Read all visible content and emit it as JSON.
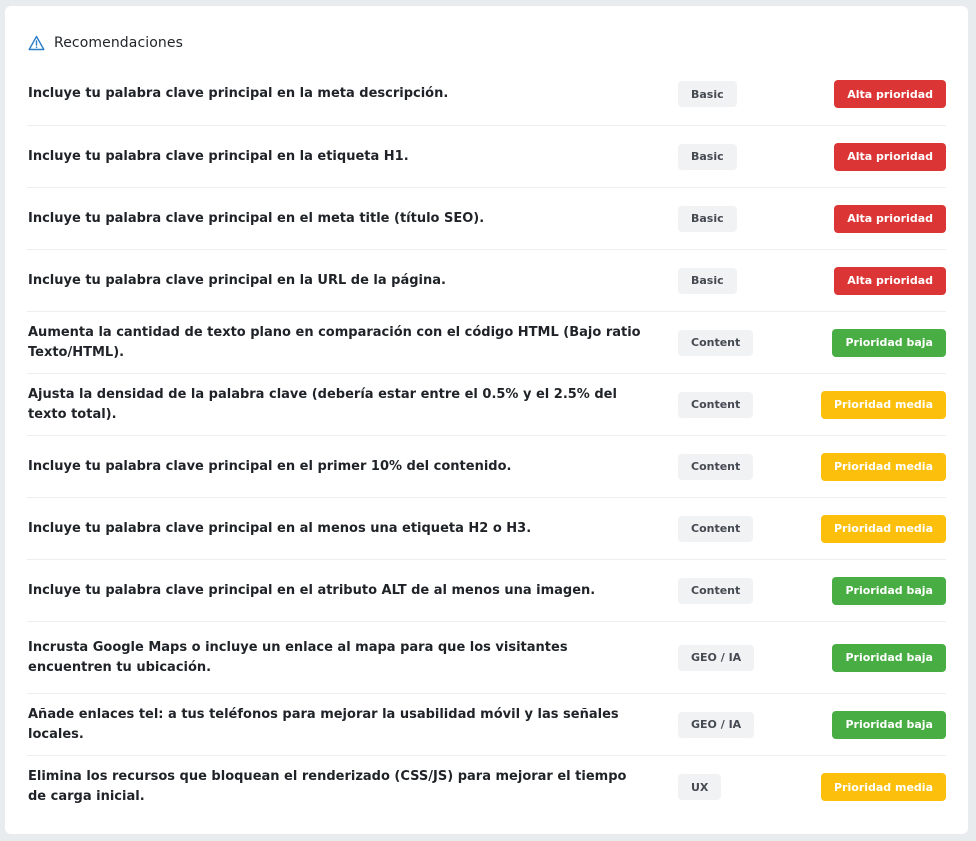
{
  "header": {
    "title": "Recomendaciones",
    "icon": "warning-icon",
    "icon_color": "#2b7ec7"
  },
  "colors": {
    "high": "#dc3535",
    "low": "#48ad42",
    "medium": "#fcbf0b"
  },
  "recommendations": [
    {
      "text": "Incluye tu palabra clave principal en la meta descripción.",
      "tag": "Basic",
      "priority": "Alta prioridad",
      "level": "high"
    },
    {
      "text": "Incluye tu palabra clave principal en la etiqueta H1.",
      "tag": "Basic",
      "priority": "Alta prioridad",
      "level": "high"
    },
    {
      "text": "Incluye tu palabra clave principal en el meta title (título SEO).",
      "tag": "Basic",
      "priority": "Alta prioridad",
      "level": "high"
    },
    {
      "text": "Incluye tu palabra clave principal en la URL de la página.",
      "tag": "Basic",
      "priority": "Alta prioridad",
      "level": "high"
    },
    {
      "text": "Aumenta la cantidad de texto plano en comparación con el código HTML (Bajo ratio Texto/HTML).",
      "tag": "Content",
      "priority": "Prioridad baja",
      "level": "low"
    },
    {
      "text": "Ajusta la densidad de la palabra clave (debería estar entre el 0.5% y el 2.5% del texto total).",
      "tag": "Content",
      "priority": "Prioridad media",
      "level": "medium"
    },
    {
      "text": "Incluye tu palabra clave principal en el primer 10% del contenido.",
      "tag": "Content",
      "priority": "Prioridad media",
      "level": "medium"
    },
    {
      "text": "Incluye tu palabra clave principal en al menos una etiqueta H2 o H3.",
      "tag": "Content",
      "priority": "Prioridad media",
      "level": "medium"
    },
    {
      "text": "Incluye tu palabra clave principal en el atributo ALT de al menos una imagen.",
      "tag": "Content",
      "priority": "Prioridad baja",
      "level": "low"
    },
    {
      "text": "Incrusta Google Maps o incluye un enlace al mapa para que los visitantes encuentren tu ubicación.",
      "tag": "GEO / IA",
      "priority": "Prioridad baja",
      "level": "low"
    },
    {
      "text": "Añade enlaces tel: a tus teléfonos para mejorar la usabilidad móvil y las señales locales.",
      "tag": "GEO / IA",
      "priority": "Prioridad baja",
      "level": "low"
    },
    {
      "text": "Elimina los recursos que bloquean el renderizado (CSS/JS) para mejorar el tiempo de carga inicial.",
      "tag": "UX",
      "priority": "Prioridad media",
      "level": "medium"
    }
  ]
}
